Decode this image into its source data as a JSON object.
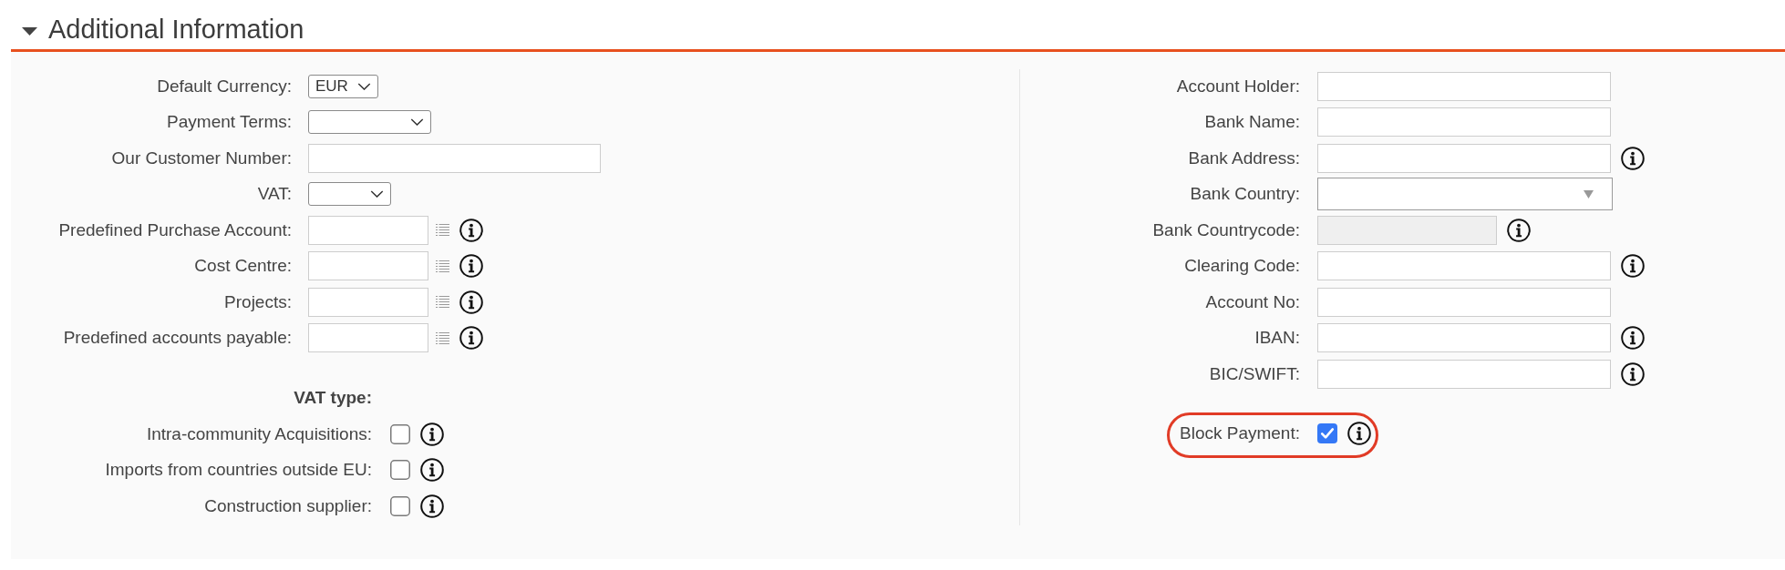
{
  "section": {
    "title": "Additional Information",
    "expanded": true
  },
  "left_fields": [
    {
      "label": "Default Currency:",
      "kind": "dropdown",
      "value": "EUR",
      "info": false
    },
    {
      "label": "Payment Terms:",
      "kind": "dropdown",
      "info": false
    },
    {
      "label": "Our Customer Number:",
      "kind": "text",
      "info": false
    },
    {
      "label": "VAT:",
      "kind": "dropdown",
      "info": false
    },
    {
      "label": "Predefined Purchase Account:",
      "kind": "lookup",
      "info": true
    },
    {
      "label": "Cost Centre:",
      "kind": "lookup",
      "info": true
    },
    {
      "label": "Projects:",
      "kind": "lookup",
      "info": true
    },
    {
      "label": "Predefined accounts payable:",
      "kind": "lookup",
      "info": true
    }
  ],
  "vat_type": {
    "heading": "VAT type:",
    "options": [
      {
        "label": "Intra-community Acquisitions:",
        "checked": false,
        "info": true
      },
      {
        "label": "Imports from countries outside EU:",
        "checked": false,
        "info": true
      },
      {
        "label": "Construction supplier:",
        "checked": false,
        "info": true
      }
    ]
  },
  "right_fields": [
    {
      "label": "Account Holder:",
      "kind": "text",
      "disabled": false,
      "info": false
    },
    {
      "label": "Bank Name:",
      "kind": "text",
      "disabled": false,
      "info": false
    },
    {
      "label": "Bank Address:",
      "kind": "text",
      "disabled": false,
      "info": true
    },
    {
      "label": "Bank Country:",
      "kind": "combobox",
      "disabled": false,
      "info": false
    },
    {
      "label": "Bank Countrycode:",
      "kind": "text",
      "disabled": true,
      "info": true
    },
    {
      "label": "Clearing Code:",
      "kind": "text",
      "disabled": false,
      "info": true
    },
    {
      "label": "Account No:",
      "kind": "text",
      "disabled": false,
      "info": false
    },
    {
      "label": "IBAN:",
      "kind": "text",
      "disabled": false,
      "info": true
    },
    {
      "label": "BIC/SWIFT:",
      "kind": "text",
      "disabled": false,
      "info": true
    }
  ],
  "block_payment": {
    "label": "Block Payment:",
    "checked": true,
    "info": true,
    "highlighted": true
  }
}
